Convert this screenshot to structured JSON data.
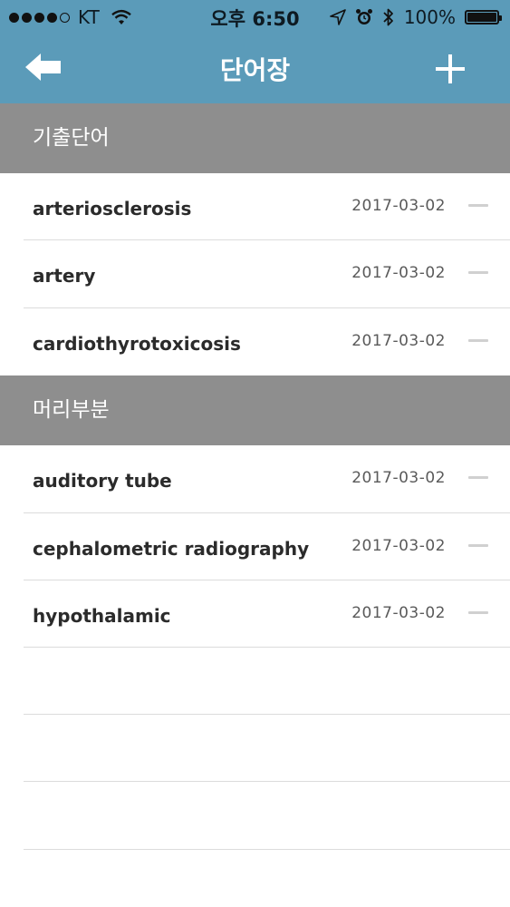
{
  "status_bar": {
    "carrier": "KT",
    "time": "오후 6:50",
    "battery": "100%"
  },
  "nav": {
    "title": "단어장"
  },
  "sections": [
    {
      "title": "기출단어",
      "items": [
        {
          "term": "arteriosclerosis",
          "date": "2017-03-02"
        },
        {
          "term": "artery",
          "date": "2017-03-02"
        },
        {
          "term": "cardiothyrotoxicosis",
          "date": "2017-03-02"
        }
      ]
    },
    {
      "title": "머리부분",
      "items": [
        {
          "term": "auditory tube",
          "date": "2017-03-02"
        },
        {
          "term": "cephalometric radiography",
          "date": "2017-03-02"
        },
        {
          "term": "hypothalamic",
          "date": "2017-03-02"
        }
      ]
    }
  ],
  "colors": {
    "header": "#5b9bb9",
    "section_header": "#8e8e8e"
  }
}
